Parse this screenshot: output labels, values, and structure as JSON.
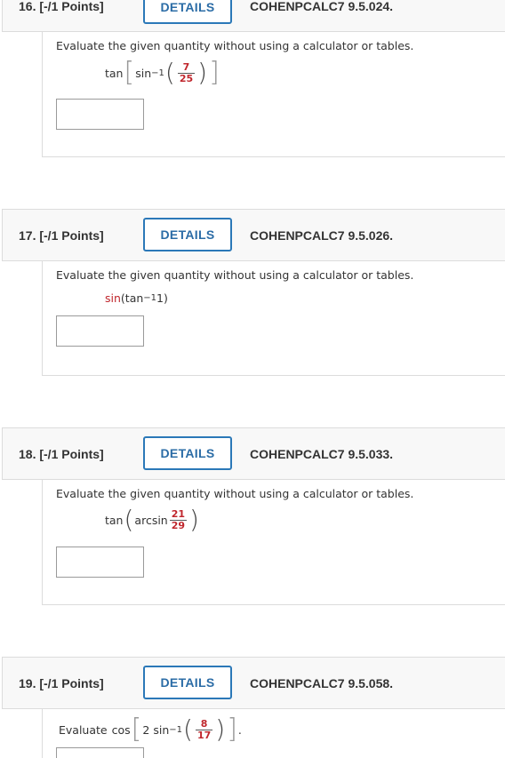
{
  "questions": [
    {
      "number": "16. [-/1 Points]",
      "details_label": "DETAILS",
      "code": "COHENPCALC7 9.5.024.",
      "prompt": "Evaluate the given quantity without using a calculator or tables.",
      "expr": {
        "func": "tan",
        "inner": "sin",
        "inv": "−1",
        "num": "7",
        "den": "25"
      }
    },
    {
      "number": "17. [-/1 Points]",
      "details_label": "DETAILS",
      "code": "COHENPCALC7 9.5.026.",
      "prompt": "Evaluate the given quantity without using a calculator or tables.",
      "expr": {
        "func": "sin",
        "inner": "(tan",
        "inv": "−1",
        "arg": " 1)"
      }
    },
    {
      "number": "18. [-/1 Points]",
      "details_label": "DETAILS",
      "code": "COHENPCALC7 9.5.033.",
      "prompt": "Evaluate the given quantity without using a calculator or tables.",
      "expr": {
        "func": "tan",
        "inner": "arcsin",
        "num": "21",
        "den": "29"
      }
    },
    {
      "number": "19. [-/1 Points]",
      "details_label": "DETAILS",
      "code": "COHENPCALC7 9.5.058.",
      "prompt": "Evaluate",
      "expr": {
        "func": "cos",
        "coef": "2",
        "inner": "sin",
        "inv": "−1",
        "num": "8",
        "den": "17",
        "end": "."
      }
    }
  ],
  "colors": {
    "accent": "#2b78b8",
    "red_text": "#c0272d",
    "header_bg": "#f8f8f8",
    "border": "#dcdcdc"
  }
}
